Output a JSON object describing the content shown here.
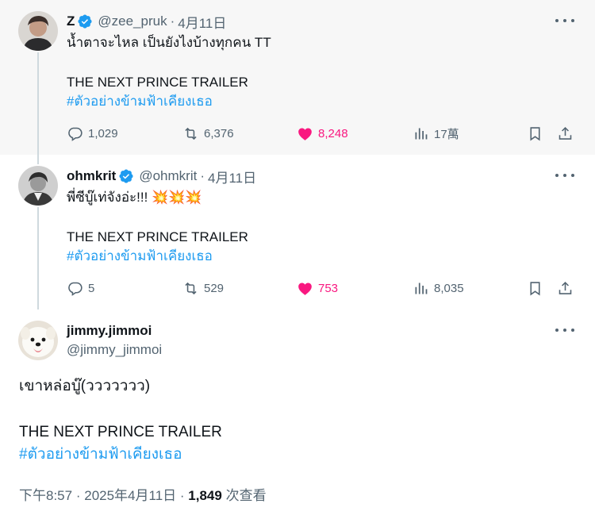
{
  "tweets": [
    {
      "name": "Z",
      "handle": "@zee_pruk",
      "sep": "·",
      "date": "4月11日",
      "text_line1": "น้ำตาจะไหล เป็นยังไงบ้างทุกคน TT",
      "text_line2": "THE NEXT PRINCE TRAILER",
      "hashtag": "#ตัวอย่างข้ามฟ้าเคียงเธอ",
      "replies": "1,029",
      "retweets": "6,376",
      "likes": "8,248",
      "views": "17萬"
    },
    {
      "name": "ohmkrit",
      "handle": "@ohmkrit",
      "sep": "·",
      "date": "4月11日",
      "text_line1": "พี่ซีบู๊เท่จังอ่ะ!!! 💥💥💥",
      "text_line2": "THE NEXT PRINCE TRAILER",
      "hashtag": "#ตัวอย่างข้ามฟ้าเคียงเธอ",
      "replies": "5",
      "retweets": "529",
      "likes": "753",
      "views": "8,035"
    }
  ],
  "main": {
    "name": "jimmy.jimmoi",
    "handle": "@jimmy_jimmoi",
    "text_line1": "เขาหล่อบู๊(ววววววว)",
    "text_line2": "THE NEXT PRINCE TRAILER",
    "hashtag": "#ตัวอย่างข้ามฟ้าเคียงเธอ",
    "time": "下午8:57",
    "sep": "·",
    "date": "2025年4月11日",
    "view_count": "1,849",
    "view_label": "次查看"
  },
  "colors": {
    "accent": "#1d9bf0",
    "like": "#f91880",
    "muted": "#536471",
    "thread_line": "#cfd9de",
    "highlight_bg": "#f7f7f7"
  },
  "icons": [
    "verified-badge-icon",
    "more-icon",
    "reply-icon",
    "retweet-icon",
    "heart-filled-icon",
    "views-icon",
    "bookmark-icon",
    "share-icon"
  ]
}
